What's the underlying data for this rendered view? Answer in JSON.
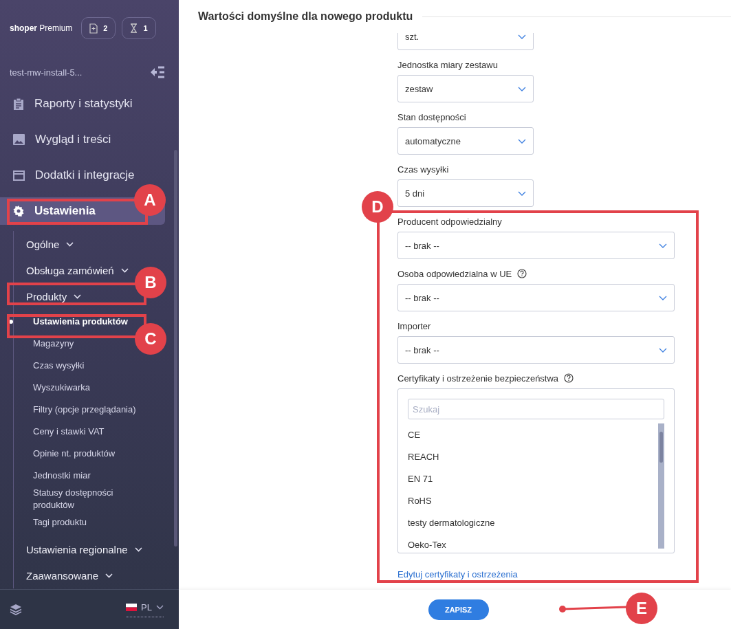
{
  "sidebar": {
    "brand": {
      "name": "shoper",
      "plan": "Premium"
    },
    "badges": [
      {
        "kind": "file",
        "count": "2"
      },
      {
        "kind": "hourglass",
        "count": "1"
      }
    ],
    "shop": "test-mw-install-5...",
    "items": [
      {
        "kind": "report",
        "label": "Raporty i statystyki",
        "selected": false
      },
      {
        "kind": "image",
        "label": "Wygląd i treści",
        "selected": false
      },
      {
        "kind": "addon",
        "label": "Dodatki i integracje",
        "selected": false
      },
      {
        "kind": "gear",
        "label": "Ustawienia",
        "selected": true,
        "children": [
          {
            "label": "Ogólne"
          },
          {
            "label": "Obsługa zamówień"
          },
          {
            "label": "Produkty",
            "children": [
              {
                "label": "Ustawienia produktów",
                "selected": true
              },
              {
                "label": "Magazyny",
                "selected": false
              },
              {
                "label": "Czas wysyłki",
                "selected": false
              },
              {
                "label": "Wyszukiwarka",
                "selected": false
              },
              {
                "label": "Filtry (opcje przeglądania)",
                "selected": false
              },
              {
                "label": "Ceny i stawki VAT",
                "selected": false
              },
              {
                "label": "Opinie nt. produktów",
                "selected": false
              },
              {
                "label": "Jednostki miar",
                "selected": false
              },
              {
                "label": "Statusy dostępności produktów",
                "selected": false
              },
              {
                "label": "Tagi produktu",
                "selected": false
              }
            ]
          },
          {
            "label": "Ustawienia regionalne"
          },
          {
            "label": "Zaawansowane"
          }
        ]
      }
    ],
    "language": "PL"
  },
  "section_title": "Wartości domyślne dla nowego produktu",
  "fields": [
    {
      "kind": "select",
      "value": "szt.",
      "wide": false
    },
    {
      "kind": "select",
      "label": "Jednostka miary zestawu",
      "value": "zestaw",
      "wide": false
    },
    {
      "kind": "select",
      "label": "Stan dostępności",
      "value": "automatyczne",
      "wide": false
    },
    {
      "kind": "select",
      "label": "Czas wysyłki",
      "value": "5 dni",
      "wide": false
    },
    {
      "kind": "select",
      "label": "Producent odpowiedzialny",
      "value": "-- brak --",
      "wide": true
    },
    {
      "kind": "select",
      "label": "Osoba odpowiedzialna w UE",
      "value": "-- brak --",
      "wide": true,
      "help": true
    },
    {
      "kind": "select",
      "label": "Importer",
      "value": "-- brak --",
      "wide": true
    },
    {
      "kind": "list",
      "label": "Certyfikaty i ostrzeżenie bezpieczeństwa",
      "help": true,
      "wide": true,
      "placeholder": "Szukaj",
      "options": [
        "CE",
        "REACH",
        "EN 71",
        "RoHS",
        "testy dermatologiczne",
        "Oeko-Tex"
      ]
    }
  ],
  "edit_link": "Edytuj certyfikaty i ostrzeżenia",
  "save_button": "ZAPISZ",
  "annotations": [
    {
      "label": "A"
    },
    {
      "label": "B"
    },
    {
      "label": "C"
    },
    {
      "label": "D"
    },
    {
      "label": "E"
    }
  ]
}
